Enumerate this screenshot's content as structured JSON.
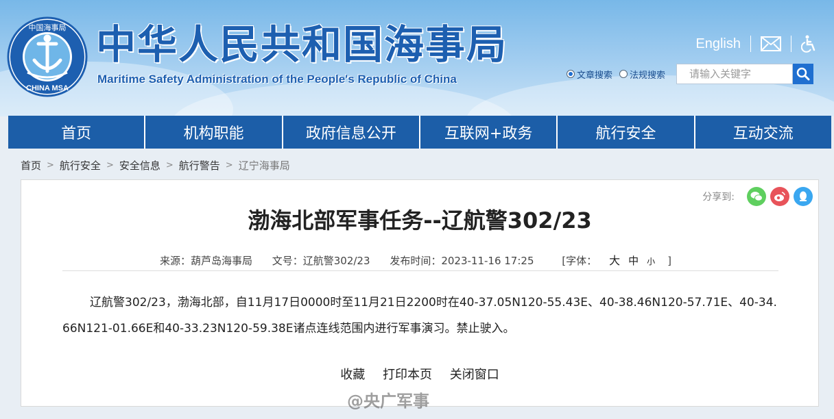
{
  "header": {
    "title": "中华人民共和国海事局",
    "subtitle": "Maritime Safety Administration of the People's Republic of China",
    "logo_text_top": "中国海事局",
    "logo_text_bottom": "CHINA MSA",
    "english_link": "English"
  },
  "search": {
    "option_article": "文章搜索",
    "option_law": "法规搜索",
    "placeholder": "请输入关键字",
    "selected": "文章搜索"
  },
  "nav": {
    "items": [
      "首页",
      "机构职能",
      "政府信息公开",
      "互联网+政务",
      "航行安全",
      "互动交流"
    ]
  },
  "breadcrumb": [
    "首页",
    "航行安全",
    "安全信息",
    "航行警告",
    "辽宁海事局"
  ],
  "article": {
    "share_label": "分享到:",
    "title": "渤海北部军事任务--辽航警302/23",
    "source": "来源：葫芦岛海事局",
    "doc_no": "文号：辽航警302/23",
    "published": "发布时间：2023-11-16 17:25",
    "font_label": "[字体：",
    "font_large": "大",
    "font_medium": "中",
    "font_small": "小",
    "font_close": "]",
    "body": "辽航警302/23，渤海北部，自11月17日0000时至11月21日2200时在40-37.05N120-55.43E、40-38.46N120-57.71E、40-34.66N121-01.66E和40-33.23N120-59.38E诸点连线范围内进行军事演习。禁止驶入。",
    "actions": [
      "收藏",
      "打印本页",
      "关闭窗口"
    ]
  },
  "watermark": "@央广军事",
  "colors": {
    "nav_bg": "#1c5ea8",
    "title_blue": "#1d5fb0",
    "search_btn": "#1f6fd0",
    "wechat": "#5fcf5f",
    "weibo": "#e8535a",
    "qq": "#3aa7f0"
  }
}
